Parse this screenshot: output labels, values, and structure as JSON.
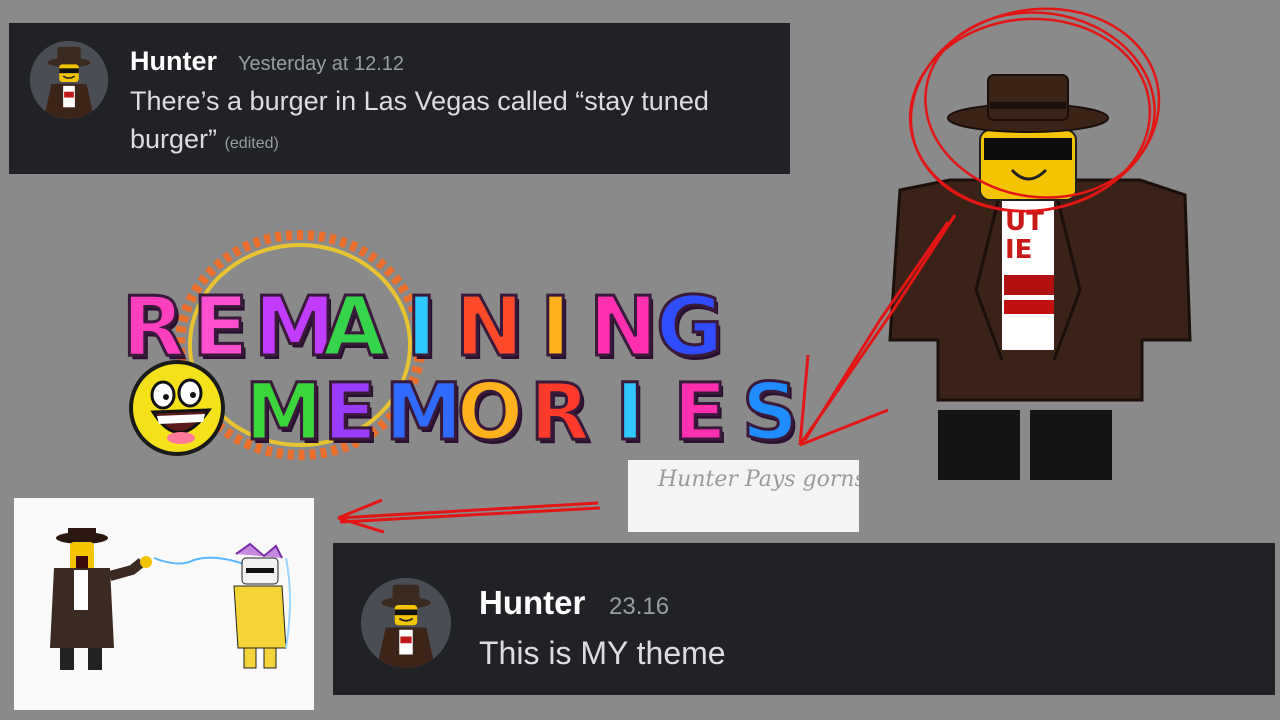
{
  "messages": {
    "top": {
      "author": "Hunter",
      "time": "Yesterday at 12.12",
      "text": "There’s a burger in Las Vegas called “stay tuned burger”",
      "edited": "(edited)"
    },
    "bottom": {
      "author": "Hunter",
      "time": "23.16",
      "text": "This is MY theme"
    }
  },
  "logo": {
    "line1": [
      "R",
      "E",
      "M",
      "A",
      "I",
      "N",
      "I",
      "N",
      "G"
    ],
    "line1_colors": [
      "#ff3fbf",
      "#ff4fd0",
      "#c23cff",
      "#36d44a",
      "#2ec8ff",
      "#ff4a2a",
      "#ffb21e",
      "#ff2fb0",
      "#2f4dff"
    ],
    "line2": [
      "M",
      "E",
      "M",
      "O",
      "R",
      "I",
      "E",
      "S"
    ],
    "line2_colors": [
      "#3ad63a",
      "#9a3cff",
      "#2f6bff",
      "#ffb21e",
      "#ff3a2a",
      "#2fc8ff",
      "#ff2fb0",
      "#1f8cff"
    ]
  },
  "note": {
    "text": "Hunter Pays gorns"
  }
}
